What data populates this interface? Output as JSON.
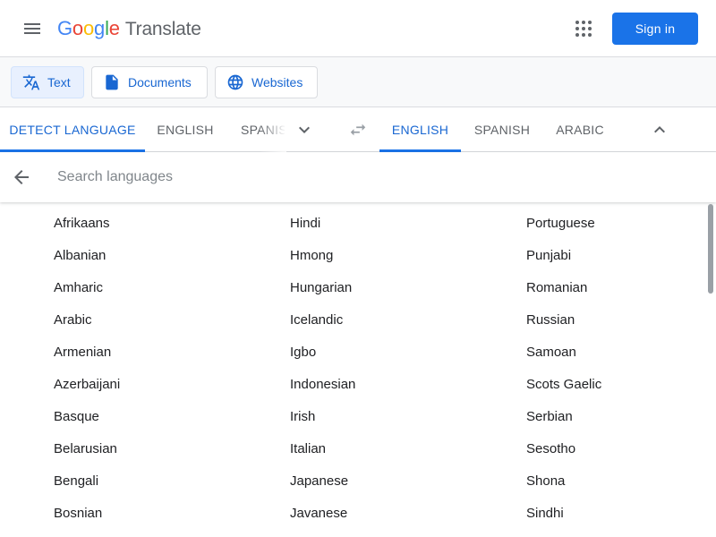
{
  "header": {
    "logo_letters": [
      {
        "ch": "G",
        "color": "#4285F4"
      },
      {
        "ch": "o",
        "color": "#EA4335"
      },
      {
        "ch": "o",
        "color": "#FBBC05"
      },
      {
        "ch": "g",
        "color": "#4285F4"
      },
      {
        "ch": "l",
        "color": "#34A853"
      },
      {
        "ch": "e",
        "color": "#EA4335"
      }
    ],
    "product": "Translate",
    "sign_in": "Sign in"
  },
  "modes": {
    "text": "Text",
    "documents": "Documents",
    "websites": "Websites"
  },
  "source_tabs": [
    "DETECT LANGUAGE",
    "ENGLISH",
    "SPANISH"
  ],
  "target_tabs": [
    "ENGLISH",
    "SPANISH",
    "ARABIC"
  ],
  "search": {
    "placeholder": "Search languages"
  },
  "languages": {
    "col0": [
      "Afrikaans",
      "Albanian",
      "Amharic",
      "Arabic",
      "Armenian",
      "Azerbaijani",
      "Basque",
      "Belarusian",
      "Bengali",
      "Bosnian"
    ],
    "col1": [
      "Hindi",
      "Hmong",
      "Hungarian",
      "Icelandic",
      "Igbo",
      "Indonesian",
      "Irish",
      "Italian",
      "Japanese",
      "Javanese"
    ],
    "col2": [
      "Portuguese",
      "Punjabi",
      "Romanian",
      "Russian",
      "Samoan",
      "Scots Gaelic",
      "Serbian",
      "Sesotho",
      "Shona",
      "Sindhi"
    ]
  },
  "colors": {
    "accent": "#1a73e8",
    "active_tab": "#1967d2",
    "muted": "#5f6368"
  },
  "icons": {
    "menu": "menu-icon",
    "apps": "apps-grid-icon",
    "text_mode": "translate-icon",
    "documents_mode": "document-icon",
    "websites_mode": "globe-icon",
    "expand_source": "chevron-down-icon",
    "swap": "swap-icon",
    "collapse_target": "chevron-up-icon",
    "back": "arrow-back-icon"
  }
}
